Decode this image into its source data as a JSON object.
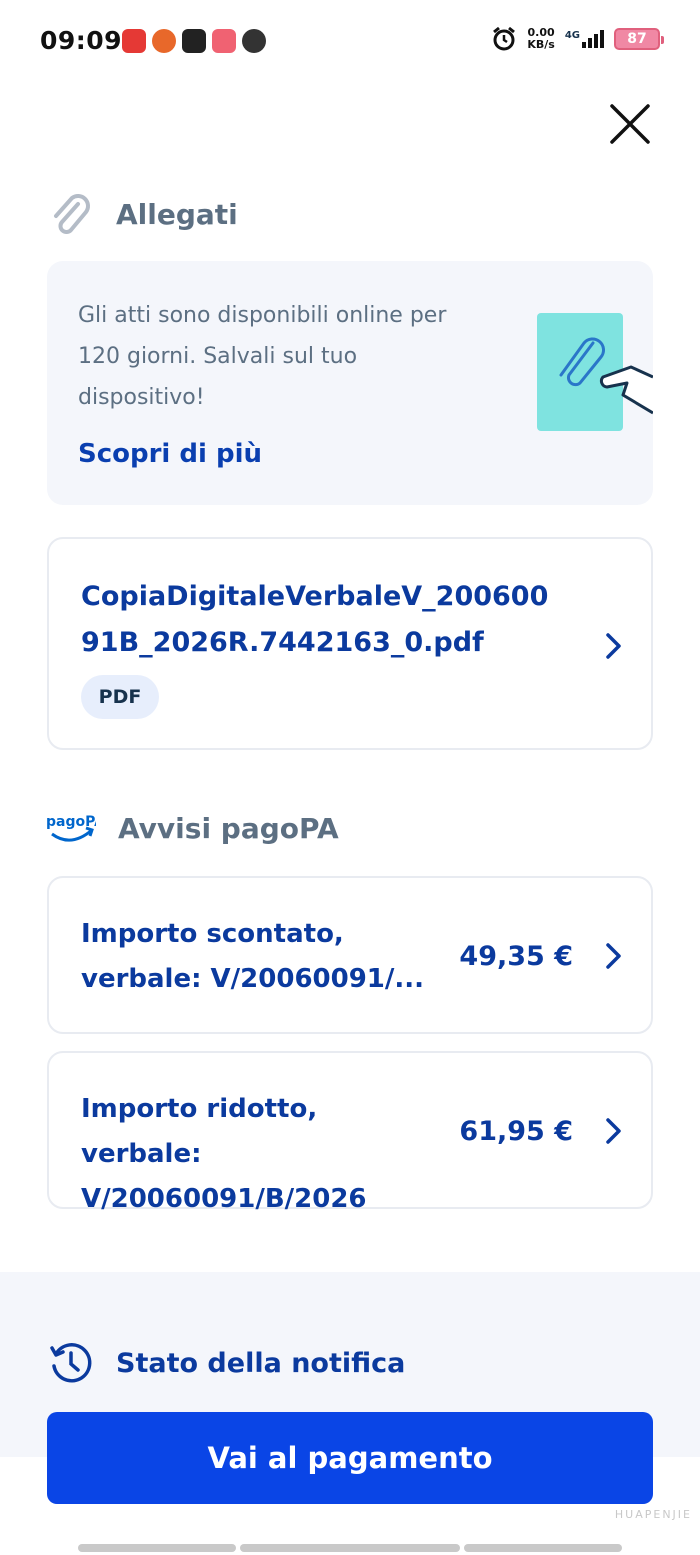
{
  "status_bar": {
    "time": "09:09",
    "net_speed_value": "0.00",
    "net_speed_unit": "KB/s",
    "network": "4G",
    "battery": "87"
  },
  "attachments": {
    "title": "Allegati",
    "info_text": "Gli atti sono disponibili online per 120 giorni. Salvali sul tuo dispositivo!",
    "info_link": "Scopri di più",
    "document": {
      "name": "CopiaDigitaleVerbaleV_20060091B_2026R.7442163_0.pdf",
      "badge": "PDF"
    }
  },
  "pagopa": {
    "logo_text": "pagoPA",
    "title": "Avvisi pagoPA",
    "items": [
      {
        "title": "Importo scontato, verbale: V/20060091/...",
        "amount": "49,35 €"
      },
      {
        "title": "Importo ridotto, verbale: V/20060091/B/2026",
        "amount": "61,95 €"
      }
    ]
  },
  "notification_state": {
    "title": "Stato della notifica"
  },
  "actions": {
    "pay_button": "Vai al pagamento"
  },
  "watermark": "HUAPENJIE",
  "colors": {
    "primary": "#0a45e6",
    "link": "#0b3a9e",
    "muted_text": "#5c6f82",
    "surface": "#f4f6fb"
  }
}
